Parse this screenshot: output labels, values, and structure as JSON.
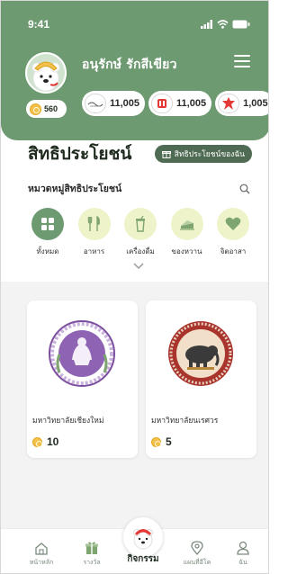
{
  "status_bar": {
    "time": "9:41"
  },
  "user": {
    "name": "อนุรักษ์ รักสีเขียว",
    "points": "560"
  },
  "balances": [
    {
      "icon": "partner-logo-icon",
      "value": "11,005"
    },
    {
      "icon": "partner-logo-icon",
      "value": "11,005"
    },
    {
      "icon": "partner-logo-icon",
      "value": "1,005"
    }
  ],
  "benefits": {
    "title": "สิทธิประโยชน์",
    "my_benefits_label": "สิทธิประโยชน์ของฉัน",
    "category_label": "หมวดหมู่สิทธิประโยชน์"
  },
  "categories": [
    {
      "label": "ทั้งหมด",
      "icon": "grid-icon",
      "active": true
    },
    {
      "label": "อาหาร",
      "icon": "fork-knife-icon",
      "active": false
    },
    {
      "label": "เครื่องดื่ม",
      "icon": "cup-icon",
      "active": false
    },
    {
      "label": "ของหวาน",
      "icon": "cake-icon",
      "active": false
    },
    {
      "label": "จิตอาสา",
      "icon": "heart-icon",
      "active": false
    }
  ],
  "cards": [
    {
      "name": "มหาวิทยาลัยเชียงใหม่",
      "points": "10"
    },
    {
      "name": "มหาวิทยาลัยนเรศวร",
      "points": "5"
    }
  ],
  "nav": [
    {
      "label": "หน้าหลัก",
      "icon": "home-icon"
    },
    {
      "label": "รางวัล",
      "icon": "gift-icon"
    },
    {
      "label": "กิจกรรม",
      "icon": "mascot-icon"
    },
    {
      "label": "แผนที่อีโค",
      "icon": "map-pin-icon"
    },
    {
      "label": "ฉัน",
      "icon": "person-icon"
    }
  ],
  "colors": {
    "primary": "#6e9a72",
    "dark_green": "#4f6b53",
    "category_bg": "#eef3c9",
    "coin": "#f2c14e"
  }
}
